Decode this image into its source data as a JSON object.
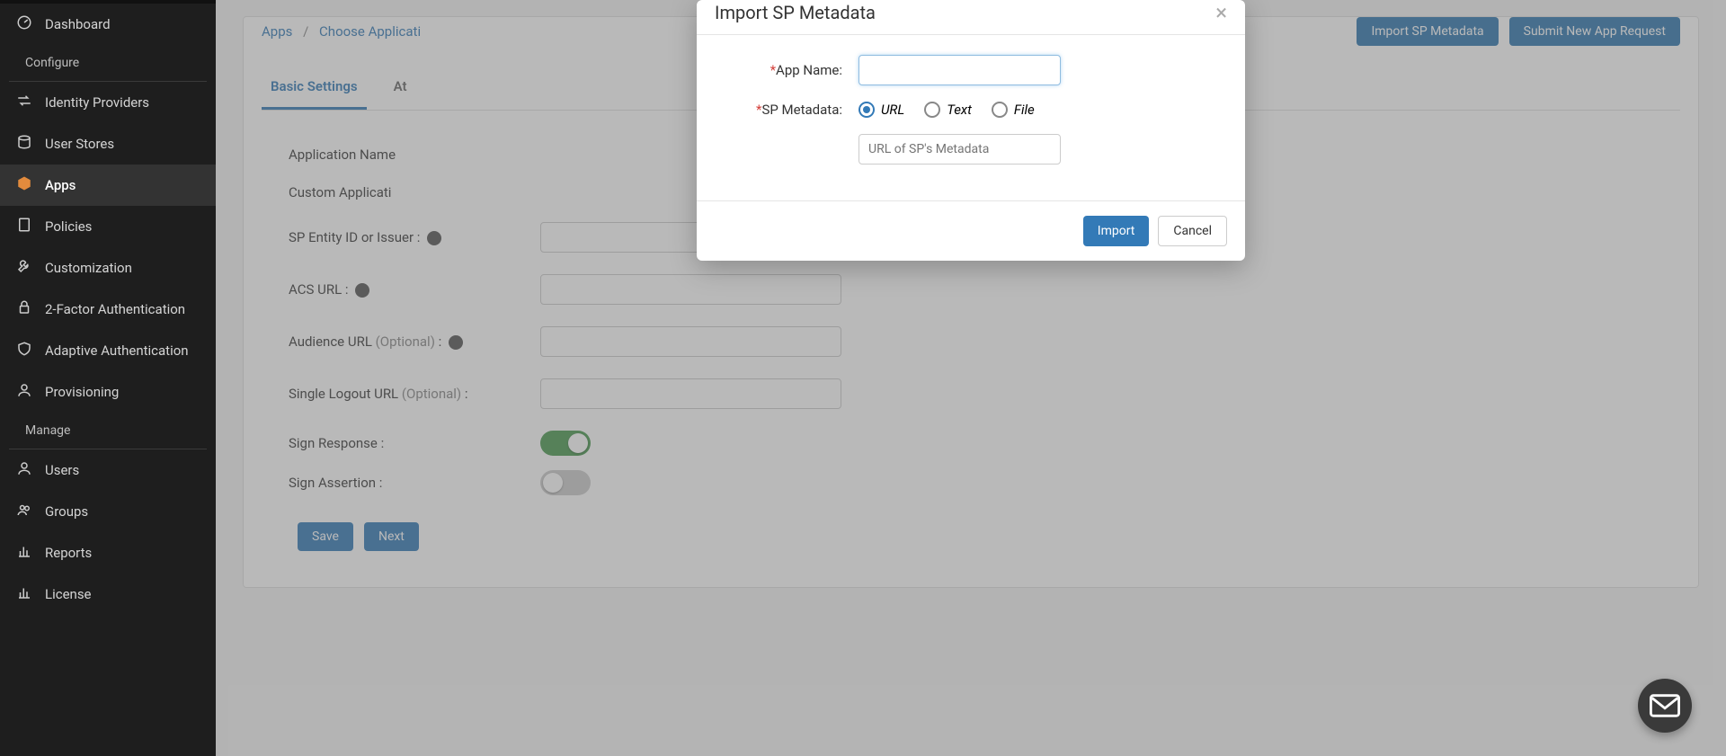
{
  "sidebar": {
    "dashboard": "Dashboard",
    "section_configure": "Configure",
    "idp": "Identity Providers",
    "userstores": "User Stores",
    "apps": "Apps",
    "policies": "Policies",
    "customization": "Customization",
    "twofa": "2-Factor Authentication",
    "adaptive": "Adaptive Authentication",
    "provisioning": "Provisioning",
    "section_manage": "Manage",
    "users": "Users",
    "groups": "Groups",
    "reports": "Reports",
    "license": "License"
  },
  "breadcrumb": {
    "apps": "Apps",
    "choose": "Choose Applicati"
  },
  "topButtons": {
    "import": "Import SP Metadata",
    "submit": "Submit New App Request"
  },
  "tabs": {
    "basic": "Basic Settings",
    "attr": "At"
  },
  "form": {
    "appName": "Application Name",
    "customApp": "Custom Applicati",
    "spEntity": "SP Entity ID or Issuer :",
    "acs": "ACS URL :",
    "audience_a": "Audience URL ",
    "audience_opt": "(Optional)",
    "audience_b": " :",
    "slo_a": "Single Logout URL ",
    "slo_opt": "(Optional)",
    "slo_b": " :",
    "signResp": "Sign Response :",
    "signAssert": "Sign Assertion :",
    "save": "Save",
    "next": "Next"
  },
  "modal": {
    "title": "Import SP Metadata",
    "appName": "App Name:",
    "spMeta": "SP Metadata:",
    "optUrl": "URL",
    "optText": "Text",
    "optFile": "File",
    "urlPlaceholder": "URL of SP's Metadata",
    "import": "Import",
    "cancel": "Cancel"
  }
}
